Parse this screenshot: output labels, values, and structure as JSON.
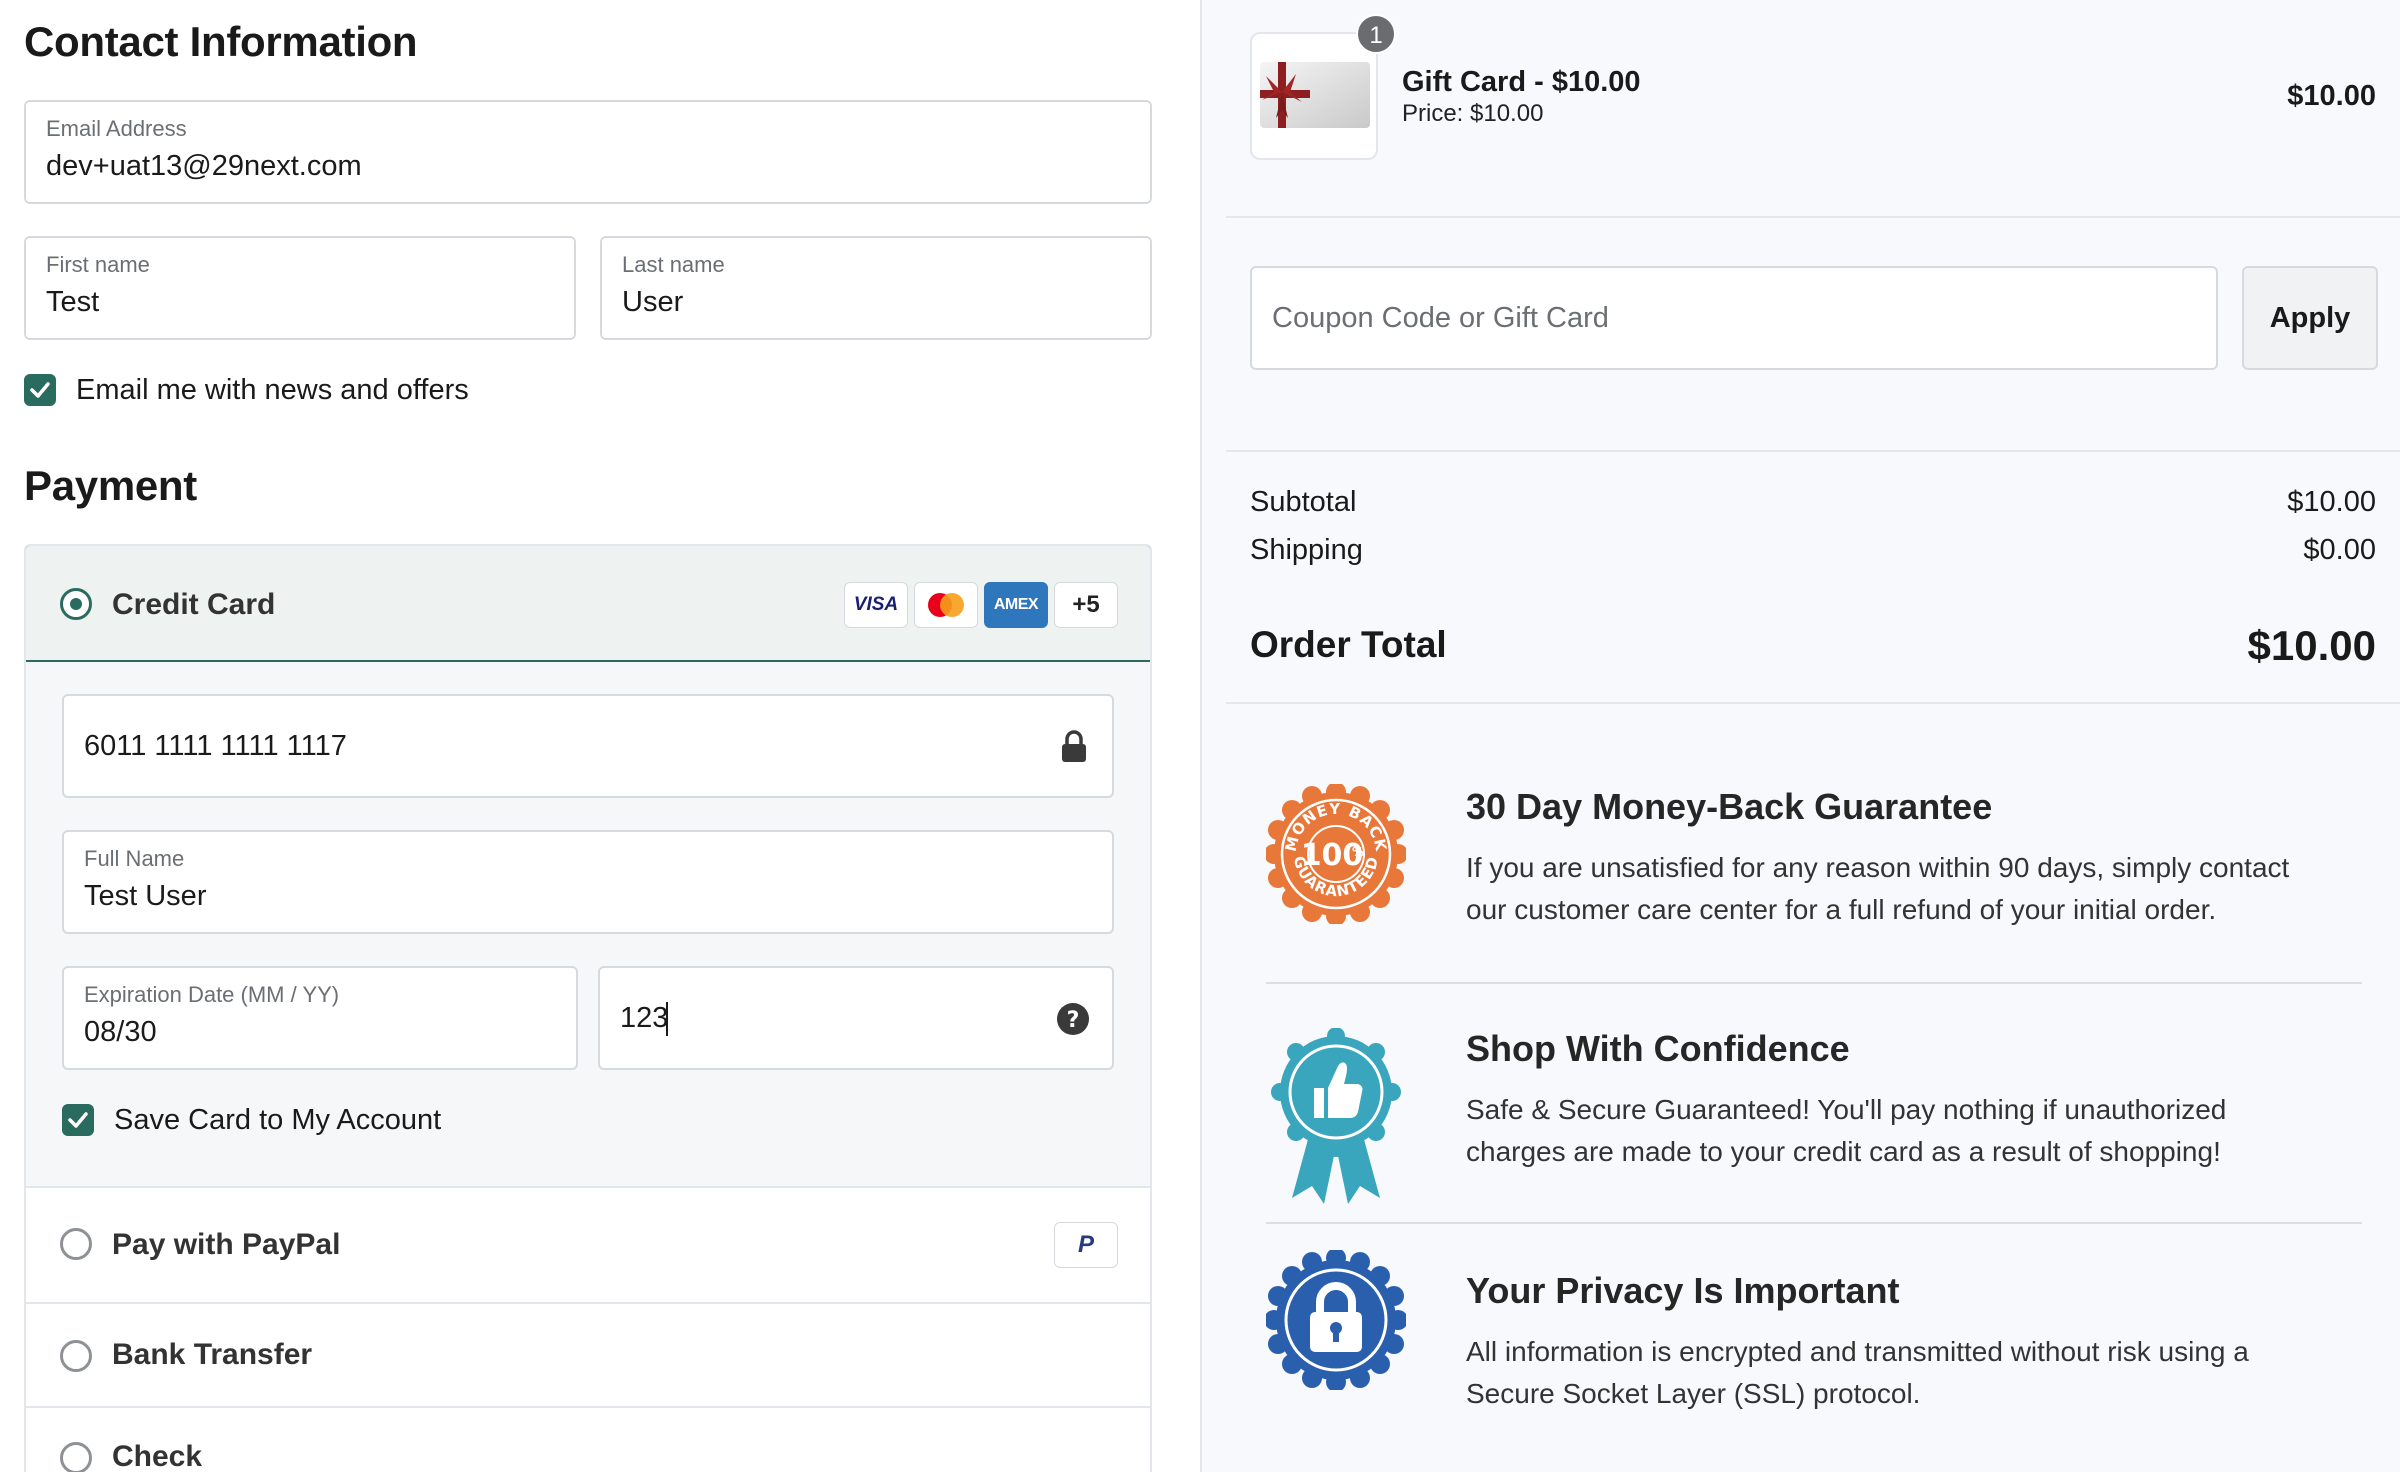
{
  "contact": {
    "title": "Contact Information",
    "email_label": "Email Address",
    "email_value": "dev+uat13@29next.com",
    "first_name_label": "First name",
    "first_name_value": "Test",
    "last_name_label": "Last name",
    "last_name_value": "User",
    "newsletter_label": "Email me with news and offers"
  },
  "payment": {
    "title": "Payment",
    "credit_card_label": "Credit Card",
    "card_badges": [
      "VISA",
      "AMEX",
      "+5"
    ],
    "card_number_value": "6011 1111 1111 1117",
    "full_name_label": "Full Name",
    "full_name_value": "Test User",
    "expiry_label": "Expiration Date (MM / YY)",
    "expiry_value": "08/30",
    "cvv_value": "123",
    "save_card_label": "Save Card to My Account",
    "paypal_label": "Pay with PayPal",
    "paypal_badge": "P",
    "bank_transfer_label": "Bank Transfer",
    "check_label": "Check"
  },
  "order": {
    "item_qty": "1",
    "item_name": "Gift Card - $10.00",
    "item_price_label": "Price: $10.00",
    "item_total": "$10.00",
    "coupon_placeholder": "Coupon Code or Gift Card",
    "apply_label": "Apply",
    "subtotal_label": "Subtotal",
    "subtotal_value": "$10.00",
    "shipping_label": "Shipping",
    "shipping_value": "$0.00",
    "total_label": "Order Total",
    "total_value": "$10.00"
  },
  "guarantees": [
    {
      "title": "30 Day Money-Back Guarantee",
      "line1": "If you are unsatisfied for any reason within 90 days, simply contact",
      "line2": "our customer care center for a full refund of your initial order.",
      "seal_top": "MONEY BACK",
      "seal_mid": "100",
      "seal_pct": "%",
      "seal_bottom": "GUARANTEED"
    },
    {
      "title": "Shop With Confidence",
      "line1": "Safe & Secure Guaranteed! You'll pay nothing if unauthorized",
      "line2": "charges are made to your credit card as a result of shopping!"
    },
    {
      "title": "Your Privacy Is Important",
      "line1": "All information is encrypted and transmitted without risk using a",
      "line2": "Secure Socket Layer (SSL) protocol."
    }
  ],
  "colors": {
    "accent": "#2a6b60",
    "seal_orange": "#e8773a",
    "seal_teal": "#3aa6bd",
    "seal_blue": "#2a5fae"
  }
}
